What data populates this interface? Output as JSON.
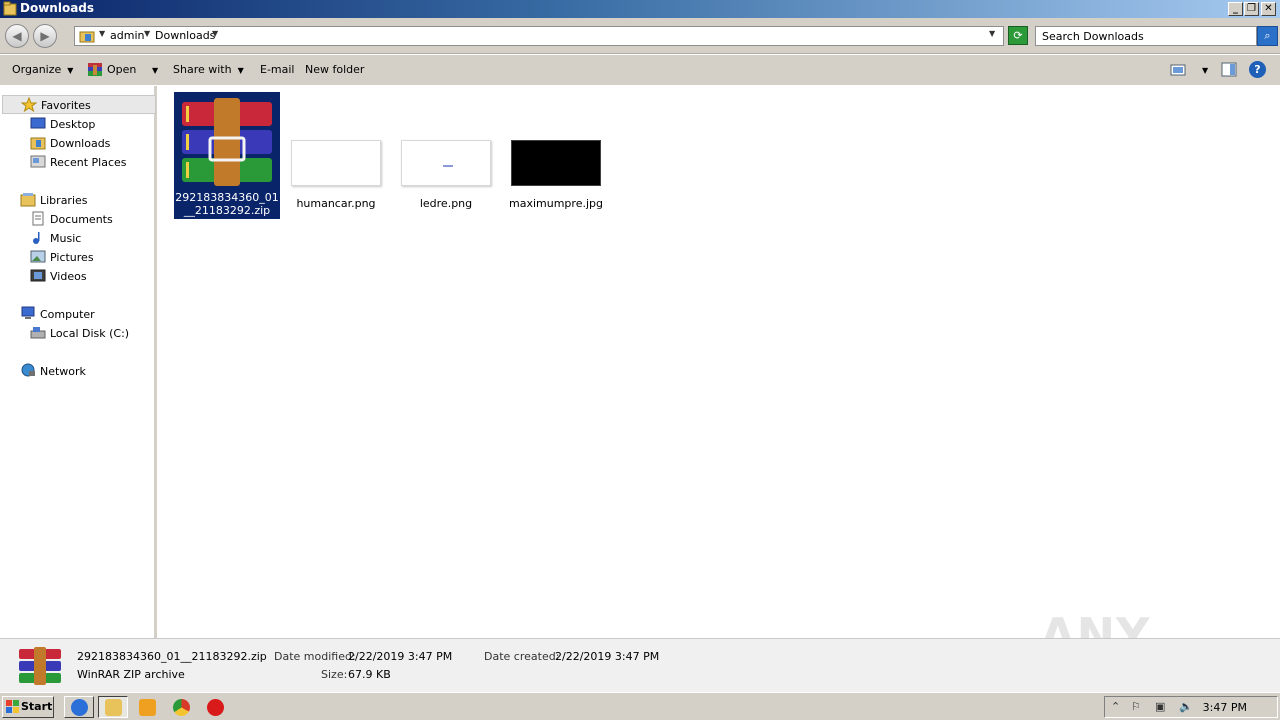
{
  "window": {
    "title": "Downloads"
  },
  "address": {
    "crumbs": [
      "admin",
      "Downloads"
    ],
    "search_placeholder": "Search Downloads"
  },
  "toolbar": {
    "organize": "Organize",
    "open": "Open",
    "share_with": "Share with",
    "email": "E-mail",
    "new_folder": "New folder"
  },
  "nav": {
    "favorites": "Favorites",
    "desktop": "Desktop",
    "downloads": "Downloads",
    "recent_places": "Recent Places",
    "libraries": "Libraries",
    "documents": "Documents",
    "music": "Music",
    "pictures": "Pictures",
    "videos": "Videos",
    "computer": "Computer",
    "local_disk": "Local Disk (C:)",
    "network": "Network"
  },
  "files": [
    {
      "name_line1": "292183834360_01",
      "name_line2": "__21183292.zip"
    },
    {
      "name": "humancar.png"
    },
    {
      "name": "ledre.png"
    },
    {
      "name": "maximumpre.jpg"
    }
  ],
  "details": {
    "filename": "292183834360_01__21183292.zip",
    "filetype": "WinRAR ZIP archive",
    "date_modified_label": "Date modified:",
    "date_modified": "2/22/2019 3:47 PM",
    "date_created_label": "Date created:",
    "date_created": "2/22/2019 3:47 PM",
    "size_label": "Size:",
    "size": "67.9 KB"
  },
  "taskbar": {
    "start": "Start",
    "clock": "3:47 PM"
  },
  "watermark": "ANY RUN",
  "colors": {
    "selection": "#0a246a",
    "title_gradient_start": "#0a246a",
    "chrome": "#d4d0c8"
  }
}
